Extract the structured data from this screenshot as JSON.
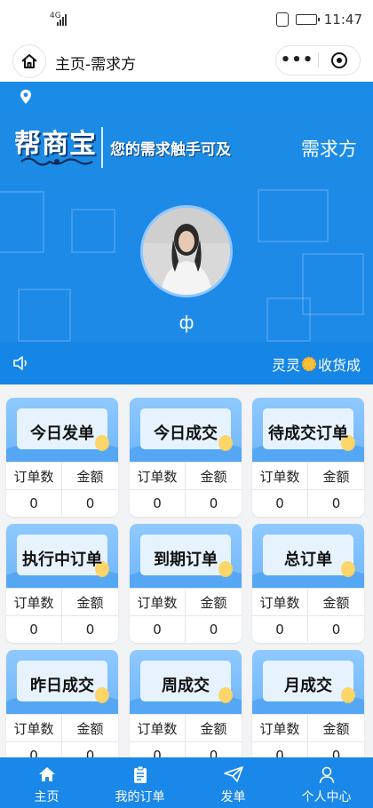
{
  "status": {
    "network": "4G",
    "time": "11:47",
    "battery_level": 0.9
  },
  "nav": {
    "title": "主页-需求方",
    "menu_dots": "•••"
  },
  "banner": {
    "brand": "帮商宝",
    "slogan": "您的需求触手可及",
    "role": "需求方"
  },
  "profile": {
    "name": "ф"
  },
  "notice": {
    "before": "灵灵",
    "after": "收货成"
  },
  "cards": [
    {
      "title": "今日发单",
      "col1": "订单数",
      "col2": "金额",
      "v1": "0",
      "v2": "0"
    },
    {
      "title": "今日成交",
      "col1": "订单数",
      "col2": "金额",
      "v1": "0",
      "v2": "0"
    },
    {
      "title": "待成交订单",
      "col1": "订单数",
      "col2": "金额",
      "v1": "0",
      "v2": "0"
    },
    {
      "title": "执行中订单",
      "col1": "订单数",
      "col2": "金额",
      "v1": "0",
      "v2": "0"
    },
    {
      "title": "到期订单",
      "col1": "订单数",
      "col2": "金额",
      "v1": "0",
      "v2": "0"
    },
    {
      "title": "总订单",
      "col1": "订单数",
      "col2": "金额",
      "v1": "0",
      "v2": "0"
    },
    {
      "title": "昨日成交",
      "col1": "订单数",
      "col2": "金额",
      "v1": "0",
      "v2": "0"
    },
    {
      "title": "周成交",
      "col1": "订单数",
      "col2": "金额",
      "v1": "0",
      "v2": "0"
    },
    {
      "title": "月成交",
      "col1": "订单数",
      "col2": "金额",
      "v1": "0",
      "v2": "0"
    }
  ],
  "tabs": [
    {
      "label": "主页",
      "icon": "home-icon"
    },
    {
      "label": "我的订单",
      "icon": "order-list-icon"
    },
    {
      "label": "发单",
      "icon": "send-icon"
    },
    {
      "label": "个人中心",
      "icon": "user-icon"
    }
  ],
  "colors": {
    "primary": "#1a88e8",
    "card_header": "#7fbfff",
    "background": "#f2f3f5"
  }
}
